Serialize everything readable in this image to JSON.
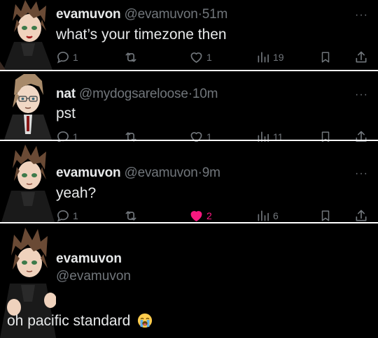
{
  "tweets": [
    {
      "name": "evamuvon",
      "handle": "@evamuvon",
      "dot": "·",
      "time": "51m",
      "text": "what’s your timezone then",
      "more": "···",
      "replies": "1",
      "retweets": "",
      "likes": "1",
      "views": "19",
      "liked": false,
      "avatar_icon": "avatar-spiky-hair-hoodie"
    },
    {
      "name": "nat",
      "handle": "@mydogsareloose",
      "dot": "·",
      "time": "10m",
      "text": "pst",
      "more": "···",
      "replies": "1",
      "retweets": "",
      "likes": "1",
      "views": "11",
      "liked": false,
      "avatar_icon": "avatar-glasses-suit"
    },
    {
      "name": "evamuvon",
      "handle": "@evamuvon",
      "dot": "·",
      "time": "9m",
      "text": "yeah?",
      "more": "···",
      "replies": "1",
      "retweets": "",
      "likes": "2",
      "views": "6",
      "liked": true,
      "avatar_icon": "avatar-spiky-hair-hoodie"
    }
  ],
  "focused_tweet": {
    "name": "evamuvon",
    "handle": "@evamuvon",
    "text": "oh pacific standard",
    "emoji": "loudly-crying-face-emoji",
    "avatar_icon": "avatar-spiky-hair-hoodie-large"
  },
  "colors": {
    "background": "#000000",
    "text": "#e7e9ea",
    "muted": "#71767b",
    "like_active": "#f91880"
  }
}
